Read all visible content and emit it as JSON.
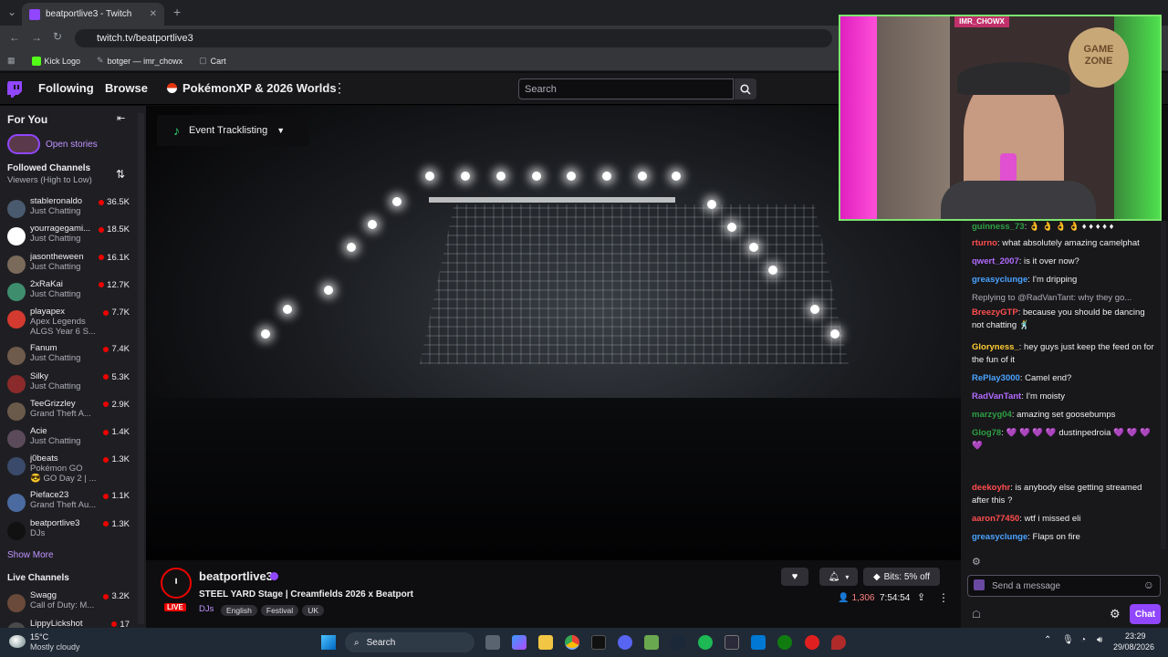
{
  "browser": {
    "tab_title": "beatportlive3 - Twitch",
    "url": "twitch.tv/beatportlive3",
    "bookmarks": [
      "Kick Logo",
      "botger — imr_chowx",
      "Cart"
    ],
    "nav_glyphs": {
      "back": "←",
      "forward": "→",
      "reload": "↻",
      "new_tab": "+",
      "tab_close": "✕",
      "tab_menu": "⌄"
    }
  },
  "topnav": {
    "following": "Following",
    "browse": "Browse",
    "promo": "PokémonXP & 2026 Worlds",
    "search_placeholder": "Search"
  },
  "sidebar": {
    "for_you": "For You",
    "open_stories": "Open stories",
    "followed_title": "Followed Channels",
    "followed_sort": "Viewers (High to Low)",
    "channels": [
      {
        "name": "stableronaldo",
        "game": "Just Chatting",
        "viewers": "36.5K",
        "color": "#4a5a6e"
      },
      {
        "name": "yourragegami...",
        "game": "Just Chatting",
        "viewers": "18.5K",
        "color": "#ffffff"
      },
      {
        "name": "jasontheween",
        "game": "Just Chatting",
        "viewers": "16.1K",
        "color": "#7a6a5a"
      },
      {
        "name": "2xRaKai",
        "game": "Just Chatting",
        "viewers": "12.7K",
        "color": "#3e8e6e"
      },
      {
        "name": "playapex",
        "game": "Apex Legends",
        "game2": "ALGS Year 6 S...",
        "viewers": "7.7K",
        "color": "#d43a2f"
      },
      {
        "name": "Fanum",
        "game": "Just Chatting",
        "viewers": "7.4K",
        "color": "#6f5b4b"
      },
      {
        "name": "Silky",
        "game": "Just Chatting",
        "viewers": "5.3K",
        "color": "#8b2a2a"
      },
      {
        "name": "TeeGrizzley",
        "game": "Grand Theft A...",
        "viewers": "2.9K",
        "color": "#6a5a4a"
      },
      {
        "name": "Acie",
        "game": "Just Chatting",
        "viewers": "1.4K",
        "color": "#5a4a5a"
      },
      {
        "name": "j0beats",
        "game": "Pokémon GO",
        "game2": "😎 GO Day 2 | ...",
        "viewers": "1.3K",
        "color": "#3a4a6a"
      },
      {
        "name": "Pieface23",
        "game": "Grand Theft Au...",
        "viewers": "1.1K",
        "color": "#4a6aa0"
      },
      {
        "name": "beatportlive3",
        "game": "DJs",
        "viewers": "1.3K",
        "color": "#111111"
      }
    ],
    "show_more": "Show More",
    "live_title": "Live Channels",
    "live_channels": [
      {
        "name": "Swagg",
        "game": "Call of Duty: M...",
        "viewers": "3.2K",
        "color": "#6a4a3a"
      },
      {
        "name": "LippyLickshot",
        "game": "",
        "viewers": "17",
        "color": "#4a4a4a"
      }
    ]
  },
  "video": {
    "event_button": "Event Tracklisting"
  },
  "stream": {
    "channel": "beatportlive3",
    "live_label": "LIVE",
    "title": "STEEL YARD Stage | Creamfields 2026 x Beatport",
    "category": "DJs",
    "tags": [
      "English",
      "Festival",
      "UK"
    ],
    "viewers": "1,306",
    "uptime": "7:54:54",
    "bits_label": "Bits: 5% off"
  },
  "webcam": {
    "overlay_name": "IMR_CHOWX",
    "sign_text": "GAME ZONE"
  },
  "chat": {
    "messages": [
      {
        "user": "guinness_73",
        "color": "#2ea043",
        "text": "👌 👌 👌 👌 ♦ ♦ ♦ ♦ ♦"
      },
      {
        "user": "rturno",
        "color": "#ff4d4d",
        "text": "what absolutely amazing camelphat"
      },
      {
        "user": "qwert_2007",
        "color": "#b36bff",
        "text": "is it over now?"
      },
      {
        "user": "greasyclunge",
        "color": "#4aa3ff",
        "text": "I'm dripping"
      },
      {
        "user": "",
        "color": "#adadb8",
        "text": "Replying to @RadVanTant: why they go..."
      },
      {
        "user": "BreezyGTP",
        "color": "#ff4d4d",
        "text": "because you should be dancing not chatting 🕺"
      },
      {
        "user": "Gloryness_",
        "color": "#ffcc33",
        "text": "hey guys just keep the feed on for the fun of it"
      },
      {
        "user": "RePlay3000",
        "color": "#4aa3ff",
        "text": "Camel end?"
      },
      {
        "user": "RadVanTant",
        "color": "#b36bff",
        "text": "I'm moisty"
      },
      {
        "user": "marzyg04",
        "color": "#2ea043",
        "text": "amazing set goosebumps"
      },
      {
        "user": "Glog78",
        "color": "#2ea043",
        "text": "💜 💜 💜 💜 dustinpedroia 💜 💜 💜 💜"
      },
      {
        "user": "deekoyhr",
        "color": "#ff4d4d",
        "text": "is anybody else getting streamed after this ?"
      },
      {
        "user": "aaron77450",
        "color": "#ff4d4d",
        "text": "wtf i missed eli"
      },
      {
        "user": "greasyclunge",
        "color": "#4aa3ff",
        "text": "Flaps on fire"
      }
    ],
    "input_placeholder": "Send a message",
    "chat_button": "Chat"
  },
  "taskbar": {
    "weather_temp": "15°C",
    "weather_desc": "Mostly cloudy",
    "search": "Search",
    "time": "23:29",
    "date": "29/08/2026"
  },
  "colors": {
    "twitch_purple": "#9146ff",
    "live_red": "#eb0400",
    "webcam_border": "#7de46f"
  }
}
